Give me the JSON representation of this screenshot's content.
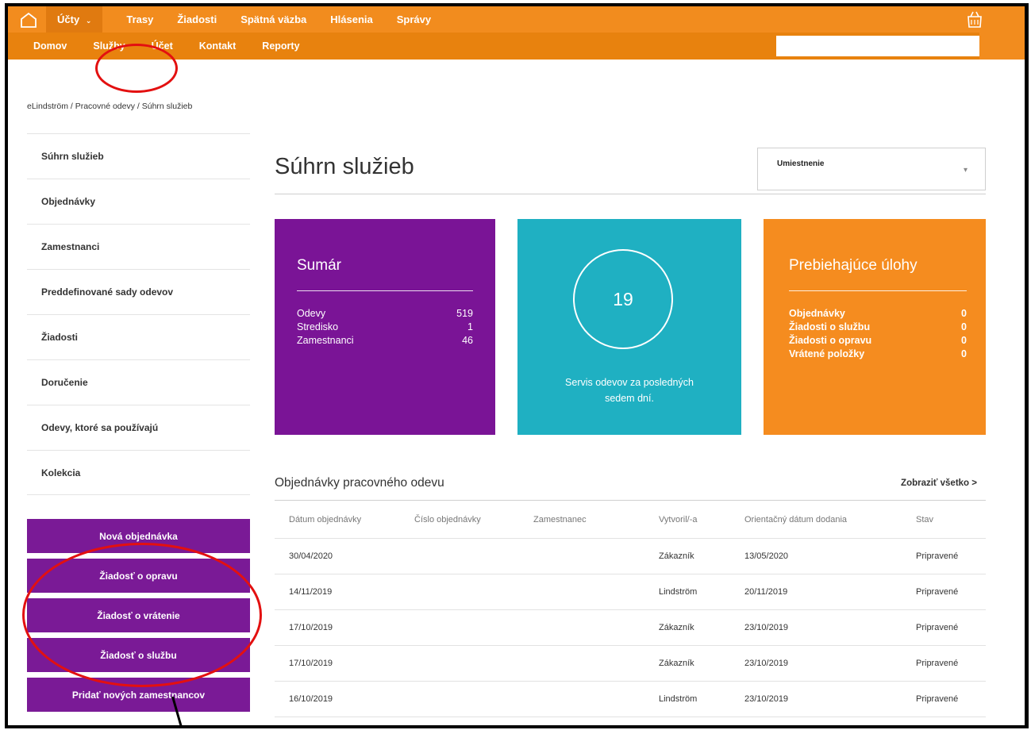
{
  "topnav": {
    "items": [
      "Účty",
      "Trasy",
      "Žiadosti",
      "Spätná väzba",
      "Hlásenia",
      "Správy"
    ]
  },
  "subnav": {
    "items": [
      "Domov",
      "Služby",
      "Účet",
      "Kontakt",
      "Reporty"
    ]
  },
  "breadcrumb": "eLindström / Pracovné odevy / Súhrn služieb",
  "sidebar": {
    "items": [
      "Súhrn služieb",
      "Objednávky",
      "Zamestnanci",
      "Preddefinované sady odevov",
      "Žiadosti",
      "Doručenie",
      "Odevy, ktoré sa používajú",
      "Kolekcia"
    ],
    "actions": [
      "Nová objednávka",
      "Žiadosť o opravu",
      "Žiadosť o vrátenie",
      "Žiadosť o službu",
      "Pridať nových zamestnancov"
    ]
  },
  "main": {
    "title": "Súhrn služieb",
    "location_label": "Umiestnenie"
  },
  "summary": {
    "title": "Sumár",
    "rows": [
      {
        "label": "Odevy",
        "value": "519"
      },
      {
        "label": "Stredisko",
        "value": "1"
      },
      {
        "label": "Zamestnanci",
        "value": "46"
      }
    ]
  },
  "service": {
    "count": "19",
    "caption_line1": "Servis odevov za posledných",
    "caption_line2": "sedem dní."
  },
  "tasks": {
    "title": "Prebiehajúce úlohy",
    "rows": [
      {
        "label": "Objednávky",
        "value": "0"
      },
      {
        "label": "Žiadosti o službu",
        "value": "0"
      },
      {
        "label": "Žiadosti o opravu",
        "value": "0"
      },
      {
        "label": "Vrátené položky",
        "value": "0"
      }
    ]
  },
  "orders": {
    "title": "Objednávky pracovného odevu",
    "show_all": "Zobraziť všetko >",
    "columns": [
      "Dátum objednávky",
      "Číslo objednávky",
      "Zamestnanec",
      "Vytvoril/-a",
      "Orientačný dátum dodania",
      "Stav"
    ],
    "rows": [
      [
        "30/04/2020",
        "",
        "",
        "Zákazník",
        "13/05/2020",
        "Pripravené"
      ],
      [
        "14/11/2019",
        "",
        "",
        "Lindström",
        "20/11/2019",
        "Pripravené"
      ],
      [
        "17/10/2019",
        "",
        "",
        "Zákazník",
        "23/10/2019",
        "Pripravené"
      ],
      [
        "17/10/2019",
        "",
        "",
        "Zákazník",
        "23/10/2019",
        "Pripravené"
      ],
      [
        "16/10/2019",
        "",
        "",
        "Lindström",
        "23/10/2019",
        "Pripravené"
      ]
    ]
  },
  "colors": {
    "orange": "#f28c1e",
    "purple": "#7a1496",
    "teal": "#1fb0c2",
    "annotation_red": "#e31010"
  }
}
